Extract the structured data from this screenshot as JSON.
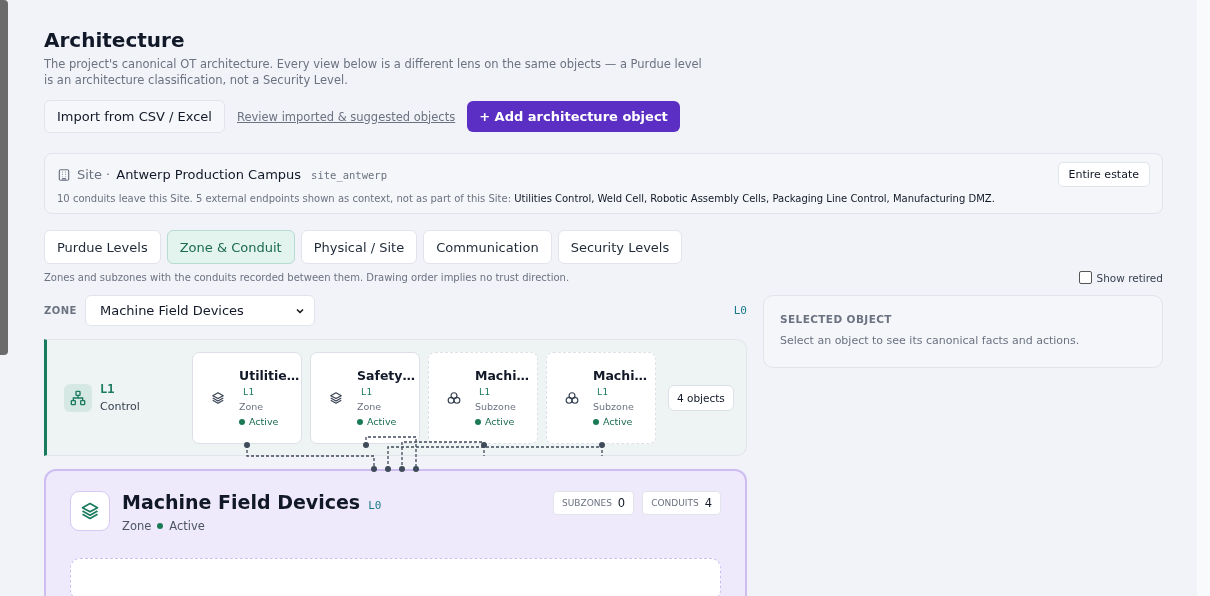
{
  "header": {
    "title": "Architecture",
    "description": "The project's canonical OT architecture. Every view below is a different lens on the same objects — a Purdue level is an architecture classification, not a Security Level."
  },
  "actions": {
    "import_button": "Import from CSV / Excel",
    "review_link": "Review imported & suggested objects",
    "add_button": "+ Add architecture object"
  },
  "site": {
    "label": "Site ·",
    "name": "Antwerp Production Campus",
    "id": "site_antwerp",
    "summary": "10 conduits leave this Site. 5 external endpoints shown as context, not as part of this Site:",
    "endpoints": "Utilities Control, Weld Cell, Robotic Assembly Cells, Packaging Line Control, Manufacturing DMZ.",
    "scope_button": "Entire estate"
  },
  "tabs": [
    {
      "label": "Purdue Levels",
      "selected": false
    },
    {
      "label": "Zone & Conduit",
      "selected": true
    },
    {
      "label": "Physical / Site",
      "selected": false
    },
    {
      "label": "Communication",
      "selected": false
    },
    {
      "label": "Security Levels",
      "selected": false
    }
  ],
  "caption": "Zones and subzones with the conduits recorded between them. Drawing order implies no trust direction.",
  "show_retired": {
    "label": "Show retired",
    "checked": false
  },
  "zone_filter": {
    "label": "ZONE",
    "value": "Machine Field Devices",
    "level": "L0"
  },
  "lane": {
    "level": "L1",
    "name": "Control",
    "count": "4 objects",
    "objects": [
      {
        "kind": "zone",
        "title": "Utilitie…",
        "level": "L1",
        "type": "Zone",
        "status": "Active",
        "color": "#1a7a55"
      },
      {
        "kind": "zone",
        "title": "Safety…",
        "level": "L1",
        "type": "Zone",
        "status": "Active",
        "color": "#1a7a55"
      },
      {
        "kind": "subzone",
        "title": "Machi…",
        "level": "L1",
        "type": "Subzone",
        "status": "Active",
        "color": "#1a7a55"
      },
      {
        "kind": "subzone",
        "title": "Machi…",
        "level": "L1",
        "type": "Subzone",
        "status": "Active",
        "color": "#1a7a55"
      }
    ]
  },
  "focus": {
    "title": "Machine Field Devices",
    "level": "L0",
    "type": "Zone",
    "status": "Active",
    "color": "#1a7a55",
    "stats": [
      {
        "label": "SUBZONES",
        "value": "0"
      },
      {
        "label": "CONDUITS",
        "value": "4"
      }
    ]
  },
  "selected_panel": {
    "title": "SELECTED OBJECT",
    "hint": "Select an object to see its canonical facts and actions."
  }
}
